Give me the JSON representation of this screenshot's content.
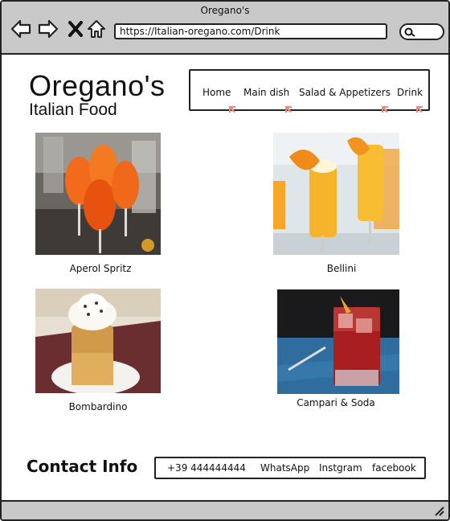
{
  "window": {
    "title": "Oregano's"
  },
  "toolbar": {
    "url": "https://Italian-oregano.com/Drink",
    "icons": [
      "back-arrow-icon",
      "forward-arrow-icon",
      "close-x-icon",
      "home-icon",
      "search-icon"
    ]
  },
  "header": {
    "title": "Oregano's",
    "subtitle": "Italian Food"
  },
  "nav": {
    "items": [
      {
        "label": "Home"
      },
      {
        "label": "Main dish"
      },
      {
        "label": "Salad & Appetizers"
      },
      {
        "label": "Drink"
      }
    ],
    "marker_color": "#e98a7c"
  },
  "drinks": [
    {
      "name": "Aperol Spritz"
    },
    {
      "name": "Bellini"
    },
    {
      "name": "Bombardino"
    },
    {
      "name": "Campari & Soda"
    }
  ],
  "contact": {
    "title": "Contact Info",
    "phone": "+39  444444444",
    "whatsapp": "WhatsApp",
    "instagram": "Instgram",
    "facebook": "facebook"
  },
  "colors": {
    "chrome_gray": "#c9c9c9",
    "border": "#222222"
  }
}
